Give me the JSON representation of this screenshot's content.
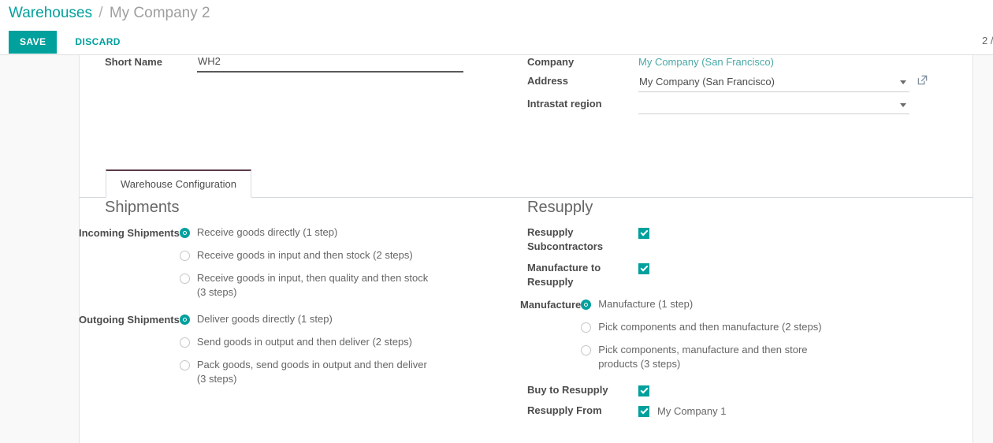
{
  "breadcrumb": {
    "root": "Warehouses",
    "separator": "/",
    "current": "My Company 2"
  },
  "toolbar": {
    "save_label": "SAVE",
    "discard_label": "DISCARD",
    "pager": "2 /"
  },
  "form_header": {
    "short_name": {
      "label": "Short Name",
      "value": "WH2"
    },
    "company": {
      "label": "Company",
      "value": "My Company (San Francisco)"
    },
    "address": {
      "label": "Address",
      "value": "My Company (San Francisco)"
    },
    "intrastat_region": {
      "label": "Intrastat region",
      "value": ""
    }
  },
  "tabs": [
    {
      "label": "Warehouse Configuration",
      "active": true
    }
  ],
  "shipments": {
    "title": "Shipments",
    "incoming": {
      "label": "Incoming Shipments",
      "options": [
        {
          "text": "Receive goods directly (1 step)",
          "selected": true
        },
        {
          "text": "Receive goods in input and then stock (2 steps)",
          "selected": false
        },
        {
          "text": "Receive goods in input, then quality and then stock (3 steps)",
          "selected": false
        }
      ]
    },
    "outgoing": {
      "label": "Outgoing Shipments",
      "options": [
        {
          "text": "Deliver goods directly (1 step)",
          "selected": true
        },
        {
          "text": "Send goods in output and then deliver (2 steps)",
          "selected": false
        },
        {
          "text": "Pack goods, send goods in output and then deliver (3 steps)",
          "selected": false
        }
      ]
    }
  },
  "resupply": {
    "title": "Resupply",
    "resupply_subcontractors": {
      "label": "Resupply Subcontractors",
      "checked": true
    },
    "manufacture_to_resupply": {
      "label": "Manufacture to Resupply",
      "checked": true
    },
    "manufacture": {
      "label": "Manufacture",
      "options": [
        {
          "text": "Manufacture (1 step)",
          "selected": true
        },
        {
          "text": "Pick components and then manufacture (2 steps)",
          "selected": false
        },
        {
          "text": "Pick components, manufacture and then store products (3 steps)",
          "selected": false
        }
      ]
    },
    "buy_to_resupply": {
      "label": "Buy to Resupply",
      "checked": true
    },
    "resupply_from": {
      "label": "Resupply From",
      "checked": true,
      "value": "My Company 1"
    }
  },
  "icons": {
    "external_link": "external-link-icon",
    "dropdown_caret": "chevron-down-icon"
  },
  "colors": {
    "accent": "#00a09d",
    "link": "#4aa8a6",
    "label": "#4c4c4c",
    "text": "#666666",
    "tab_active_border": "#5c3b49"
  }
}
